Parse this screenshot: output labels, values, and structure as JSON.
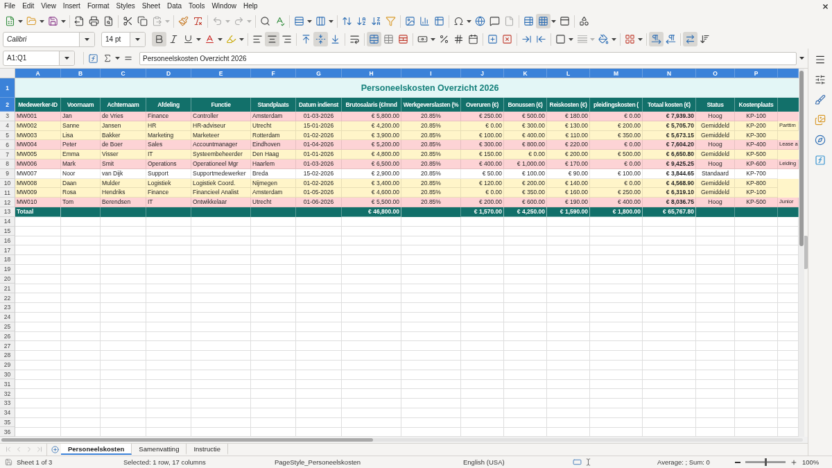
{
  "menu_bar": {
    "items": [
      "File",
      "Edit",
      "View",
      "Insert",
      "Format",
      "Styles",
      "Sheet",
      "Data",
      "Tools",
      "Window",
      "Help"
    ]
  },
  "standard_toolbar": {
    "buttons": [
      {
        "pressed": false,
        "disabled": false
      },
      {
        "pressed": false,
        "disabled": false
      },
      {
        "pressed": false,
        "disabled": false
      },
      {
        "pressed": false,
        "disabled": false
      },
      {
        "pressed": false,
        "disabled": false
      },
      {
        "pressed": false,
        "disabled": false
      },
      {
        "pressed": false,
        "disabled": false
      },
      {
        "pressed": false,
        "disabled": false
      },
      {
        "pressed": false,
        "disabled": true
      },
      {
        "pressed": false,
        "disabled": false
      },
      {
        "pressed": false,
        "disabled": false
      },
      {
        "pressed": false,
        "disabled": true
      },
      {
        "pressed": false,
        "disabled": true
      },
      {
        "pressed": false,
        "disabled": false
      },
      {
        "pressed": false,
        "disabled": false
      },
      {
        "pressed": false,
        "disabled": false
      },
      {
        "pressed": false,
        "disabled": false
      },
      {
        "pressed": false,
        "disabled": false
      },
      {
        "pressed": false,
        "disabled": false
      },
      {
        "pressed": false,
        "disabled": false
      },
      {
        "pressed": false,
        "disabled": false
      },
      {
        "pressed": false,
        "disabled": false
      },
      {
        "pressed": false,
        "disabled": false
      },
      {
        "pressed": false,
        "disabled": false
      },
      {
        "pressed": false,
        "disabled": false
      },
      {
        "pressed": false,
        "disabled": false
      },
      {
        "pressed": false,
        "disabled": false
      },
      {
        "pressed": false,
        "disabled": true
      },
      {
        "pressed": false,
        "disabled": false
      },
      {
        "pressed": true,
        "disabled": false
      },
      {
        "pressed": false,
        "disabled": false
      },
      {
        "pressed": false,
        "disabled": false
      }
    ]
  },
  "formatting_toolbar": {
    "font_name": "Calibri",
    "font_size": "14 pt",
    "buttons": [
      {
        "pressed": true,
        "disabled": false
      },
      {
        "pressed": false,
        "disabled": false
      },
      {
        "pressed": false,
        "disabled": false
      },
      {
        "pressed": false,
        "disabled": false
      },
      {
        "pressed": false,
        "disabled": false
      },
      {
        "pressed": false,
        "disabled": false
      },
      {
        "pressed": true,
        "disabled": false
      },
      {
        "pressed": false,
        "disabled": false
      },
      {
        "pressed": false,
        "disabled": false
      },
      {
        "pressed": true,
        "disabled": false
      },
      {
        "pressed": false,
        "disabled": false
      },
      {
        "pressed": false,
        "disabled": false
      },
      {
        "pressed": true,
        "disabled": false
      },
      {
        "pressed": false,
        "disabled": false
      },
      {
        "pressed": false,
        "disabled": false
      },
      {
        "pressed": false,
        "disabled": false
      },
      {
        "pressed": false,
        "disabled": false
      },
      {
        "pressed": false,
        "disabled": false
      },
      {
        "pressed": false,
        "disabled": false
      },
      {
        "pressed": false,
        "disabled": false
      },
      {
        "pressed": false,
        "disabled": false
      },
      {
        "pressed": false,
        "disabled": false
      },
      {
        "pressed": false,
        "disabled": false
      },
      {
        "pressed": false,
        "disabled": false
      },
      {
        "pressed": false,
        "disabled": true
      },
      {
        "pressed": false,
        "disabled": false
      },
      {
        "pressed": false,
        "disabled": false
      },
      {
        "pressed": true,
        "disabled": false
      },
      {
        "pressed": false,
        "disabled": false
      },
      {
        "pressed": true,
        "disabled": false
      },
      {
        "pressed": false,
        "disabled": false
      }
    ]
  },
  "formula_bar": {
    "name_box": "A1:Q1",
    "formula": "Personeelskosten Overzicht 2026"
  },
  "sheet": {
    "column_headers": [
      {
        "label": "A",
        "selected": true
      },
      {
        "label": "B",
        "selected": true
      },
      {
        "label": "C",
        "selected": true
      },
      {
        "label": "D",
        "selected": true
      },
      {
        "label": "E",
        "selected": true
      },
      {
        "label": "F",
        "selected": true
      },
      {
        "label": "G",
        "selected": true
      },
      {
        "label": "H",
        "selected": true
      },
      {
        "label": "I",
        "selected": true
      },
      {
        "label": "J",
        "selected": true
      },
      {
        "label": "K",
        "selected": true
      },
      {
        "label": "L",
        "selected": true
      },
      {
        "label": "M",
        "selected": true
      },
      {
        "label": "N",
        "selected": true
      },
      {
        "label": "O",
        "selected": true
      },
      {
        "label": "P",
        "selected": true
      }
    ],
    "row_headers": [
      {
        "label": "1",
        "selected": true
      },
      {
        "label": "2",
        "selected": true
      },
      {
        "label": "3",
        "selected": false
      },
      {
        "label": "4",
        "selected": false
      },
      {
        "label": "5",
        "selected": false
      },
      {
        "label": "6",
        "selected": false
      },
      {
        "label": "7",
        "selected": false
      },
      {
        "label": "8",
        "selected": false
      },
      {
        "label": "9",
        "selected": false
      },
      {
        "label": "10",
        "selected": false
      },
      {
        "label": "11",
        "selected": false
      },
      {
        "label": "12",
        "selected": false
      },
      {
        "label": "13",
        "selected": false
      },
      {
        "label": "14",
        "selected": false
      },
      {
        "label": "15",
        "selected": false
      },
      {
        "label": "16",
        "selected": false
      },
      {
        "label": "17",
        "selected": false
      },
      {
        "label": "18",
        "selected": false
      },
      {
        "label": "19",
        "selected": false
      },
      {
        "label": "20",
        "selected": false
      },
      {
        "label": "21",
        "selected": false
      },
      {
        "label": "22",
        "selected": false
      },
      {
        "label": "23",
        "selected": false
      },
      {
        "label": "24",
        "selected": false
      },
      {
        "label": "25",
        "selected": false
      },
      {
        "label": "26",
        "selected": false
      },
      {
        "label": "27",
        "selected": false
      },
      {
        "label": "28",
        "selected": false
      },
      {
        "label": "29",
        "selected": false
      },
      {
        "label": "30",
        "selected": false
      },
      {
        "label": "31",
        "selected": false
      },
      {
        "label": "32",
        "selected": false
      },
      {
        "label": "33",
        "selected": false
      },
      {
        "label": "34",
        "selected": false
      },
      {
        "label": "35",
        "selected": false
      },
      {
        "label": "36",
        "selected": false
      }
    ],
    "title": "Personeelskosten Overzicht 2026",
    "columns": [
      "Medewerker-ID",
      "Voornaam",
      "Achternaam",
      "Afdeling",
      "Functie",
      "Standplaats",
      "Datum indienst",
      "Brutosalaris (€/mnd",
      "Werkgeverslasten (%",
      "Overuren (€)",
      "Bonussen (€)",
      "Reiskosten (€)",
      "pleidingskosten (",
      "Totaal kosten (€)",
      "Status",
      "Kostenplaats"
    ],
    "rows": [
      {
        "color": "#fdd3d5",
        "cells": [
          "MW001",
          "Jan",
          "de Vries",
          "Finance",
          "Controller",
          "Amsterdam",
          "01-03-2026",
          "€ 5,800.00",
          "20.85%",
          "€ 250.00",
          "€ 500.00",
          "€ 180.00",
          "€ 0.00",
          "€ 7,939.30",
          "Hoog",
          "KP-100"
        ]
      },
      {
        "color": "#fff5c9",
        "cells": [
          "MW002",
          "Sanne",
          "Jansen",
          "HR",
          "HR-adviseur",
          "Utrecht",
          "15-01-2026",
          "€ 4,200.00",
          "20.85%",
          "€ 0.00",
          "€ 300.00",
          "€ 130.00",
          "€ 200.00",
          "€ 5,705.70",
          "Gemiddeld",
          "KP-200"
        ],
        "column_17": "Parttim"
      },
      {
        "color": "#fff5c9",
        "cells": [
          "MW003",
          "Lisa",
          "Bakker",
          "Marketing",
          "Marketeer",
          "Rotterdam",
          "01-02-2026",
          "€ 3,900.00",
          "20.85%",
          "€ 100.00",
          "€ 400.00",
          "€ 110.00",
          "€ 350.00",
          "€ 5,673.15",
          "Gemiddeld",
          "KP-300"
        ]
      },
      {
        "color": "#fdd3d5",
        "cells": [
          "MW004",
          "Peter",
          "de Boer",
          "Sales",
          "Accountmanager",
          "Eindhoven",
          "01-04-2026",
          "€ 5,200.00",
          "20.85%",
          "€ 300.00",
          "€ 800.00",
          "€ 220.00",
          "€ 0.00",
          "€ 7,604.20",
          "Hoog",
          "KP-400"
        ],
        "column_17": "Lease a"
      },
      {
        "color": "#fff5c9",
        "cells": [
          "MW005",
          "Emma",
          "Visser",
          "IT",
          "Systeembeheerder",
          "Den Haag",
          "01-01-2026",
          "€ 4,800.00",
          "20.85%",
          "€ 150.00",
          "€ 0.00",
          "€ 200.00",
          "€ 500.00",
          "€ 6,650.80",
          "Gemiddeld",
          "KP-500"
        ]
      },
      {
        "color": "#fdd3d5",
        "cells": [
          "MW006",
          "Mark",
          "Smit",
          "Operations",
          "Operationeel Mgr",
          "Haarlem",
          "01-03-2026",
          "€ 6,500.00",
          "20.85%",
          "€ 400.00",
          "€ 1,000.00",
          "€ 170.00",
          "€ 0.00",
          "€ 9,425.25",
          "Hoog",
          "KP-600"
        ],
        "column_17": "Leiding"
      },
      {
        "color": "#ffffff",
        "cells": [
          "MW007",
          "Noor",
          "van Dijk",
          "Support",
          "Supportmedewerker",
          "Breda",
          "15-02-2026",
          "€ 2,900.00",
          "20.85%",
          "€ 50.00",
          "€ 100.00",
          "€ 90.00",
          "€ 100.00",
          "€ 3,844.65",
          "Standaard",
          "KP-700"
        ]
      },
      {
        "color": "#fff5c9",
        "cells": [
          "MW008",
          "Daan",
          "Mulder",
          "Logistiek",
          "Logistiek Coord.",
          "Nijmegen",
          "01-02-2026",
          "€ 3,400.00",
          "20.85%",
          "€ 120.00",
          "€ 200.00",
          "€ 140.00",
          "€ 0.00",
          "€ 4,568.90",
          "Gemiddeld",
          "KP-800"
        ]
      },
      {
        "color": "#fff5c9",
        "cells": [
          "MW009",
          "Rosa",
          "Hendriks",
          "Finance",
          "Financieel Analist",
          "Amsterdam",
          "01-05-2026",
          "€ 4,600.00",
          "20.85%",
          "€ 0.00",
          "€ 350.00",
          "€ 160.00",
          "€ 250.00",
          "€ 6,319.10",
          "Gemiddeld",
          "KP-100"
        ]
      },
      {
        "color": "#fdd3d5",
        "cells": [
          "MW010",
          "Tom",
          "Berendsen",
          "IT",
          "Ontwikkelaar",
          "Utrecht",
          "01-06-2026",
          "€ 5,500.00",
          "20.85%",
          "€ 200.00",
          "€ 600.00",
          "€ 190.00",
          "€ 400.00",
          "€ 8,036.75",
          "Hoog",
          "KP-500"
        ],
        "column_17": "Junior"
      }
    ],
    "total_row": {
      "label": "Totaal",
      "gross_salary": "€ 46,800.00",
      "overtime": "€ 1,570.00",
      "bonuses": "€ 4,250.00",
      "travel_costs": "€ 1,590.00",
      "training_costs": "€ 1,800.00",
      "total_costs": "€ 65,767.80"
    }
  },
  "sheet_navigation": [
    {
      "disabled": true
    },
    {
      "disabled": true
    },
    {
      "disabled": true
    },
    {
      "disabled": true
    }
  ],
  "sheet_tabs": [
    {
      "label": "Personeelskosten",
      "selected": true
    },
    {
      "label": "Samenvatting",
      "selected": false
    },
    {
      "label": "Instructie",
      "selected": false
    }
  ],
  "status_bar": {
    "sheet": "Sheet 1 of 3",
    "selection": "Selected: 1 row, 17 columns",
    "page_style": "PageStyle_Personeelskosten",
    "language": "English (USA)",
    "summary": "Average: ; Sum: 0",
    "zoom": {
      "level": 0.5,
      "reading": "100%"
    }
  }
}
